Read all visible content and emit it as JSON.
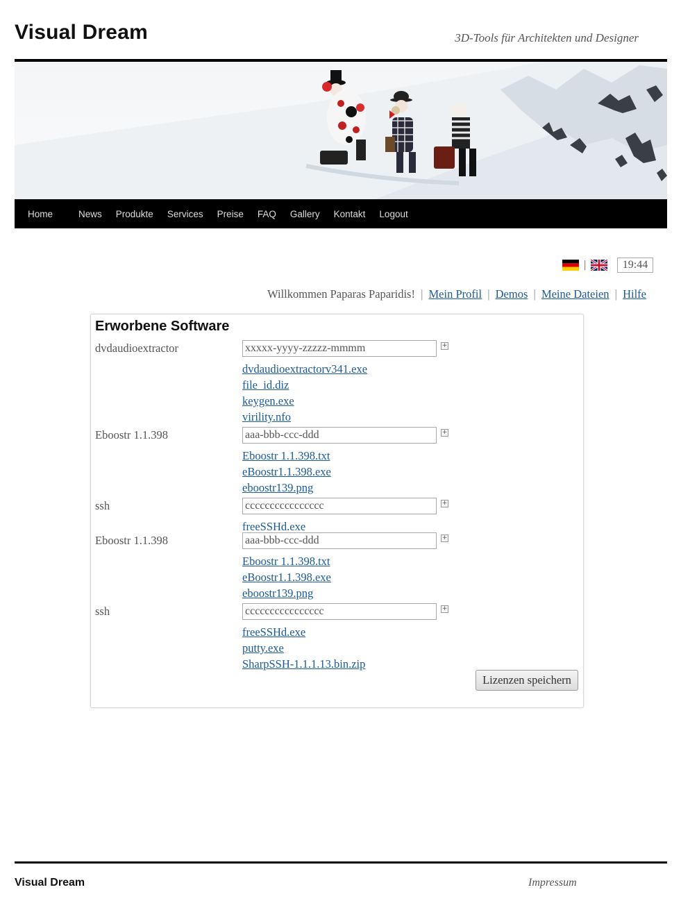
{
  "site": {
    "title": "Visual Dream",
    "tagline": "3D-Tools für Architekten und Designer"
  },
  "nav": {
    "items": [
      {
        "label": "Home"
      },
      {
        "label": "News"
      },
      {
        "label": "Produkte"
      },
      {
        "label": "Services"
      },
      {
        "label": "Preise"
      },
      {
        "label": "FAQ"
      },
      {
        "label": "Gallery"
      },
      {
        "label": "Kontakt"
      },
      {
        "label": "Logout"
      }
    ]
  },
  "tools": {
    "flags": [
      "de-flag-icon",
      "uk-flag-icon"
    ],
    "separator": "|",
    "clock": "19:44"
  },
  "welcome": {
    "greeting": "Willkommen Paparas Paparidis!",
    "separator": "|",
    "links": [
      "Mein Profil",
      "Demos",
      "Meine Dateien",
      "Hilfe"
    ]
  },
  "panel": {
    "title": "Erworbene Software",
    "entries": [
      {
        "product": "dvdaudioextractor",
        "license": "xxxxx-yyyy-zzzzz-mmmm",
        "files": [
          "dvdaudioextractorv341.exe",
          "file_id.diz",
          "keygen.exe",
          "virility.nfo"
        ]
      },
      {
        "product": "Eboostr 1.1.398",
        "license": "aaa-bbb-ccc-ddd",
        "files": [
          "Eboostr 1.1.398.txt",
          "eBoostr1.1.398.exe",
          "eboostr139.png"
        ]
      },
      {
        "product": "ssh",
        "license": "cccccccccccccccc",
        "files": [
          "freeSSHd.exe"
        ]
      },
      {
        "product": "Eboostr 1.1.398",
        "license": "aaa-bbb-ccc-ddd",
        "files": [
          "Eboostr 1.1.398.txt",
          "eBoostr1.1.398.exe",
          "eboostr139.png"
        ]
      },
      {
        "product": "ssh",
        "license": "cccccccccccccccc",
        "files": [
          "freeSSHd.exe",
          "putty.exe",
          "SharpSSH-1.1.1.13.bin.zip"
        ]
      }
    ],
    "save_label": "Lizenzen speichern"
  },
  "footer": {
    "title": "Visual Dream",
    "link": "Impressum"
  },
  "colors": {
    "link": "#1a5a9a",
    "nav_bg": "#000000",
    "nav_text": "#dddddd"
  }
}
